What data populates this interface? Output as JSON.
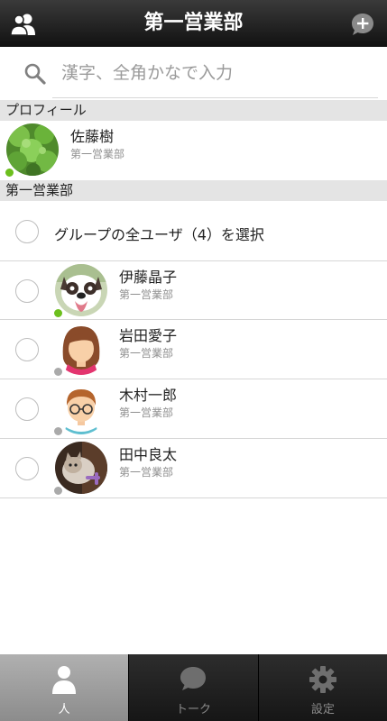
{
  "header": {
    "title": "第一営業部"
  },
  "search": {
    "placeholder": "漢字、全角かなで入力"
  },
  "sections": {
    "profile_label": "プロフィール",
    "group_label": "第一営業部"
  },
  "profile": {
    "name": "佐藤樹",
    "dept": "第一営業部",
    "status": "online"
  },
  "group": {
    "select_all_label": "グループの全ユーザ（4）を選択",
    "members": [
      {
        "name": "伊藤晶子",
        "dept": "第一営業部",
        "status": "online"
      },
      {
        "name": "岩田愛子",
        "dept": "第一営業部",
        "status": "offline"
      },
      {
        "name": "木村一郎",
        "dept": "第一営業部",
        "status": "offline"
      },
      {
        "name": "田中良太",
        "dept": "第一営業部",
        "status": "offline"
      }
    ]
  },
  "tabs": [
    {
      "label": "人",
      "icon": "person-icon",
      "active": true
    },
    {
      "label": "トーク",
      "icon": "chat-bubble-icon",
      "active": false
    },
    {
      "label": "設定",
      "icon": "gear-icon",
      "active": false
    }
  ],
  "colors": {
    "online": "#6cbf1d",
    "offline": "#aaaaaa",
    "header_bg": "#1a1a1a",
    "section_bg": "#e4e4e4"
  }
}
